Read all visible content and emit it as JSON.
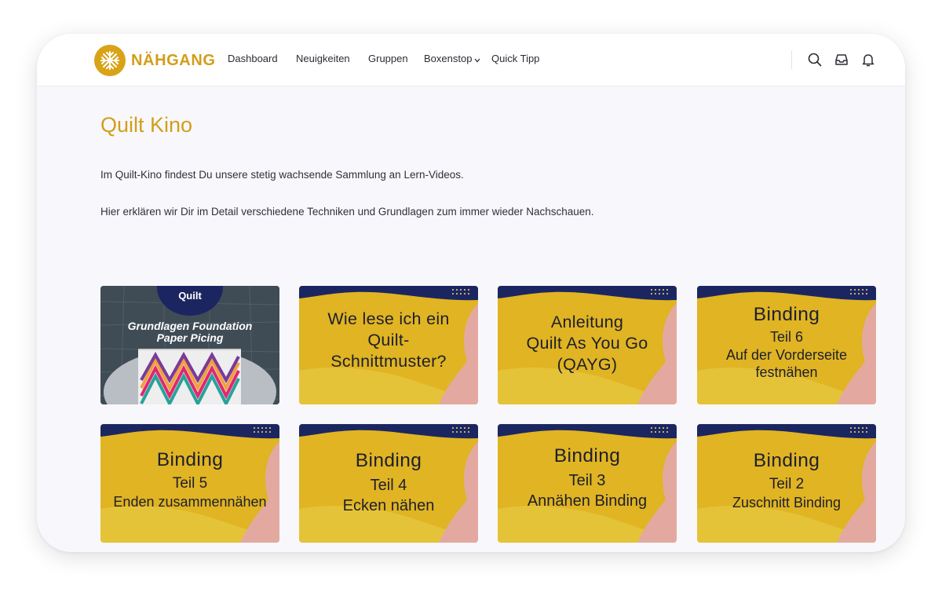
{
  "brand": {
    "name": "NÄHGANG"
  },
  "nav": {
    "items": [
      {
        "label": "Dashboard"
      },
      {
        "label": "Neuigkeiten"
      },
      {
        "label": "Gruppen"
      },
      {
        "label": "Boxenstop"
      },
      {
        "label": "Quick Tipp"
      }
    ]
  },
  "header_icons": [
    "search-icon",
    "inbox-icon",
    "bell-icon"
  ],
  "page": {
    "title": "Quilt Kino",
    "intro_1": "Im Quilt-Kino findest Du unsere stetig wachsende Sammlung an Lern-Videos.",
    "intro_2": "Hier erklären wir Dir im Detail verschiedene Techniken und Grundlagen zum immer wieder Nachschauen."
  },
  "colors": {
    "accent": "#d29e1a",
    "card_yellow": "#e3b925",
    "card_navy": "#1b2661",
    "card_pink": "#e3a9a0",
    "text": "#2f2f3a"
  },
  "videos": [
    {
      "brand": "Quilt",
      "lines": [
        "Grundlagen Foundation",
        "Paper Picing"
      ]
    },
    {
      "lines": [
        "Wie lese ich ein",
        "Quilt-",
        "Schnittmuster?"
      ]
    },
    {
      "lines": [
        "Anleitung",
        "Quilt As You Go",
        "(QAYG)"
      ]
    },
    {
      "lines": [
        "Binding",
        "Teil 6",
        "Auf der Vorderseite",
        "festnähen"
      ]
    },
    {
      "lines": [
        "Binding",
        "Teil 5",
        "Enden zusammennähen"
      ]
    },
    {
      "lines": [
        "Binding",
        "Teil 4",
        "Ecken nähen"
      ]
    },
    {
      "lines": [
        "Binding",
        "Teil 3",
        "Annähen Binding"
      ]
    },
    {
      "lines": [
        "Binding",
        "Teil 2",
        "Zuschnitt Binding"
      ]
    }
  ]
}
